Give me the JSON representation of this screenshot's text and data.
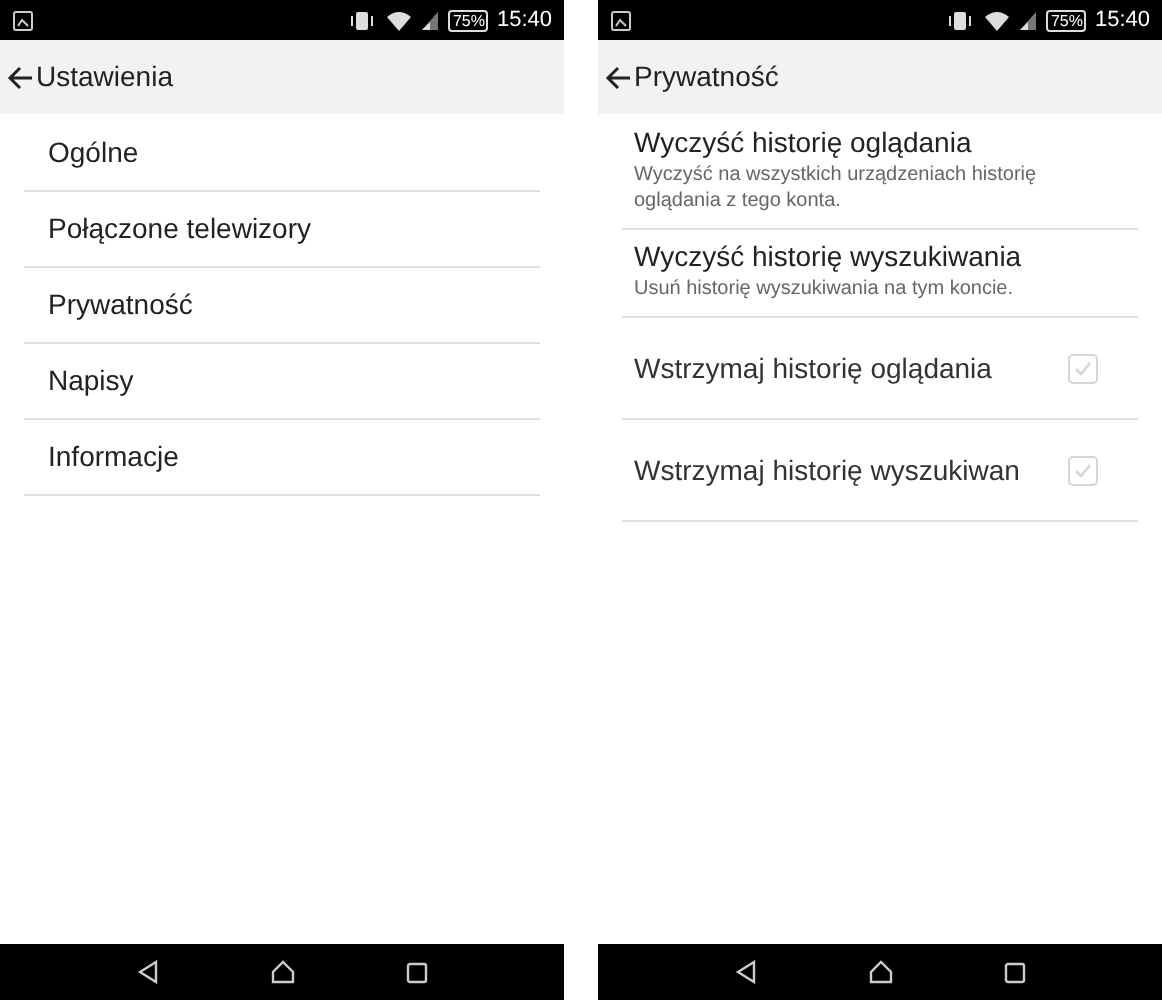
{
  "screens": [
    {
      "status_bar": {
        "battery": "75%",
        "time": "15:40"
      },
      "header": {
        "title": "Ustawienia"
      },
      "items": [
        {
          "kind": "link",
          "title": "Ogólne"
        },
        {
          "kind": "link",
          "title": "Połączone telewizory"
        },
        {
          "kind": "link",
          "title": "Prywatność"
        },
        {
          "kind": "link",
          "title": "Napisy"
        },
        {
          "kind": "link",
          "title": "Informacje"
        }
      ]
    },
    {
      "status_bar": {
        "battery": "75%",
        "time": "15:40"
      },
      "header": {
        "title": "Prywatność"
      },
      "items": [
        {
          "kind": "action",
          "title": "Wyczyść historię oglądania",
          "subtitle": "Wyczyść na wszystkich urządzeniach historię oglądania z tego konta."
        },
        {
          "kind": "action",
          "title": "Wyczyść historię wyszukiwania",
          "subtitle": "Usuń historię wyszukiwania na tym koncie."
        },
        {
          "kind": "checkbox",
          "title": "Wstrzymaj historię oglądania",
          "checked": true,
          "disabled": true
        },
        {
          "kind": "checkbox",
          "title": "Wstrzymaj historię wyszukiwan",
          "checked": true,
          "disabled": true
        }
      ]
    }
  ]
}
